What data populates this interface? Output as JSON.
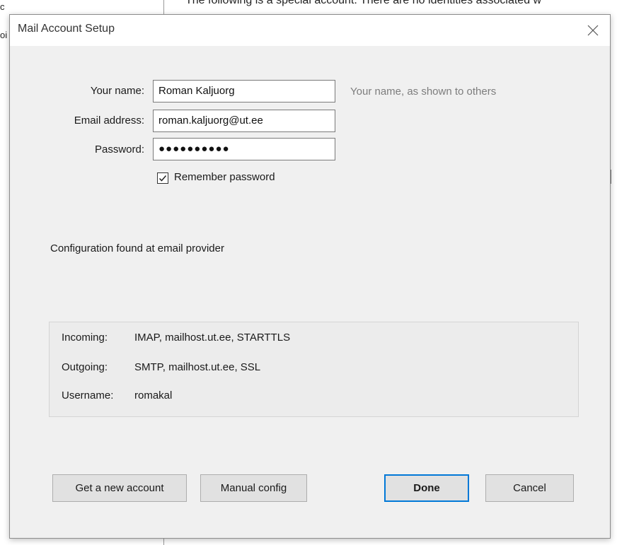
{
  "background": {
    "top_text": "The following is a special account. There are no identities associated w",
    "left_text_1": "c",
    "left_text_2": "oi"
  },
  "dialog": {
    "title": "Mail Account Setup",
    "close_icon": "close-icon"
  },
  "form": {
    "name_label": "Your name:",
    "name_value": "Roman Kaljuorg",
    "name_hint": "Your name, as shown to others",
    "email_label": "Email address:",
    "email_value": "roman.kaljuorg@ut.ee",
    "password_label": "Password:",
    "password_masked": "●●●●●●●●●●",
    "remember_label": "Remember password",
    "remember_checked": true
  },
  "status": {
    "text": "Configuration found at email provider"
  },
  "summary": {
    "rows": [
      {
        "key": "Incoming:",
        "value": "IMAP, mailhost.ut.ee, STARTTLS"
      },
      {
        "key": "Outgoing:",
        "value": "SMTP, mailhost.ut.ee, SSL"
      },
      {
        "key": "Username:",
        "value": "romakal"
      }
    ]
  },
  "buttons": {
    "get_new_account": "Get a new account",
    "manual_config": "Manual config",
    "done": "Done",
    "cancel": "Cancel"
  },
  "colors": {
    "dialog_bg": "#f0f0f0",
    "default_button_border": "#0078d7",
    "hint_text": "#7d7d7d"
  }
}
